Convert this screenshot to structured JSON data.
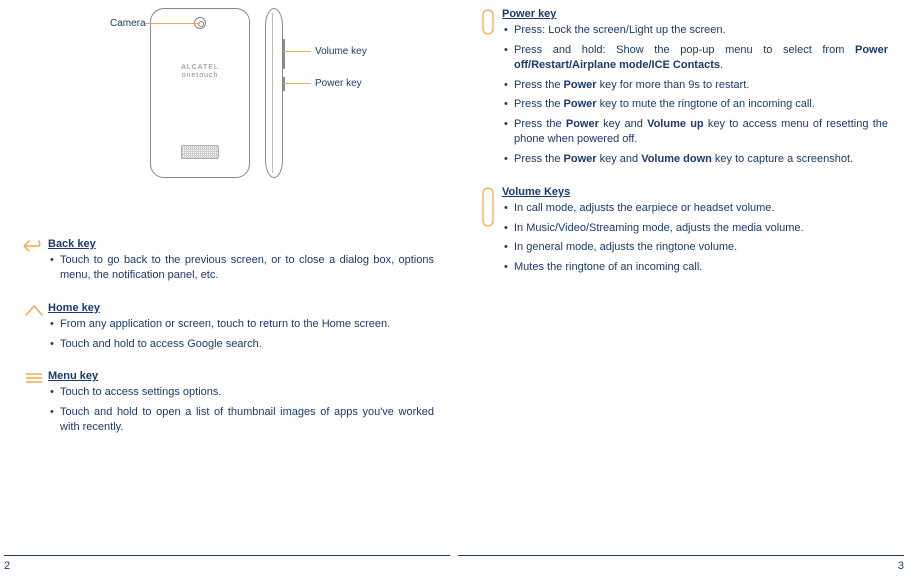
{
  "diagram": {
    "labels": {
      "camera": "Camera",
      "volume": "Volume key",
      "power": "Power key"
    },
    "brand_line1": "ALCATEL",
    "brand_line2": "onetouch"
  },
  "left_page": {
    "back_key": {
      "title": "Back key",
      "items": [
        "Touch to go back to the previous screen, or to close a dialog box, options menu, the notification panel, etc."
      ]
    },
    "home_key": {
      "title": "Home key",
      "items": [
        "From any application or screen, touch to return to the Home screen.",
        "Touch and hold to access Google search."
      ]
    },
    "menu_key": {
      "title": "Menu key",
      "items": [
        "Touch to access settings options.",
        "Touch and hold to open a list of thumbnail images of apps you've worked with recently."
      ]
    },
    "page_number": "2"
  },
  "right_page": {
    "power_key": {
      "title": "Power key",
      "items_pre": [
        "Press: Lock the screen/Light up the screen."
      ],
      "item_popup_pre": "Press and hold: Show the pop-up menu to select from ",
      "item_popup_bold": "Power off/Restart/Airplane mode/ICE Contacts",
      "item_popup_post": ".",
      "item_restart_pre": "Press the ",
      "item_restart_bold": "Power",
      "item_restart_post": " key for more than 9s to restart.",
      "item_mute_pre": "Press the ",
      "item_mute_bold": "Power",
      "item_mute_post": " key to mute the ringtone of an incoming call.",
      "item_reset_pre": "Press the ",
      "item_reset_b1": "Power",
      "item_reset_mid": " key and ",
      "item_reset_b2": "Volume up",
      "item_reset_post": " key to access menu of resetting the phone when powered off.",
      "item_shot_pre": "Press the ",
      "item_shot_b1": "Power",
      "item_shot_mid": " key and ",
      "item_shot_b2": "Volume down",
      "item_shot_post": " key to capture a screenshot."
    },
    "volume_keys": {
      "title": "Volume Keys ",
      "items": [
        "In call mode,  adjusts the earpiece or headset volume.",
        "In Music/Video/Streaming mode, adjusts the media volume.",
        "In general mode, adjusts the ringtone volume.",
        "Mutes the ringtone of an incoming call."
      ]
    },
    "page_number": "3"
  }
}
